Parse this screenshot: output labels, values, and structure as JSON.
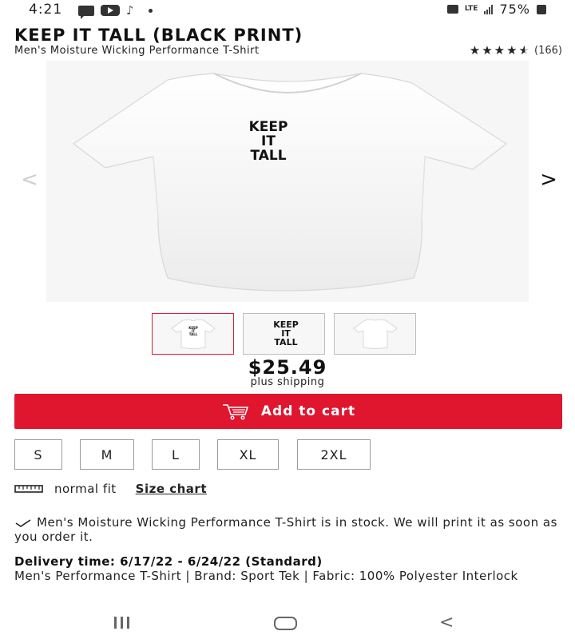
{
  "status_bar": {
    "time": "4:21",
    "network": "LTE",
    "battery": "75%"
  },
  "product": {
    "title": "KEEP IT TALL (BLACK PRINT)",
    "subtitle": "Men's Moisture Wicking Performance T-Shirt",
    "rating": 4.5,
    "rating_count": "(166)",
    "print_lines": [
      "KEEP",
      "IT",
      "TALL"
    ],
    "price": "$25.49",
    "shipping": "plus shipping"
  },
  "gallery": {
    "prev_arrow": "<",
    "next_arrow": ">"
  },
  "cart": {
    "button_label": "Add to cart",
    "icon": "cart-icon"
  },
  "sizes": [
    "S",
    "M",
    "L",
    "XL",
    "2XL"
  ],
  "fit": {
    "icon": "ruler-icon",
    "label": "normal fit",
    "size_chart_link": "Size chart"
  },
  "stock": {
    "check_icon": "check-icon",
    "message": "Men's Moisture Wicking Performance T-Shirt is in stock. We will print it as soon as you order it."
  },
  "delivery": {
    "label": "Delivery time: 6/17/22 - 6/24/22 (Standard)"
  },
  "description": "Men's Performance T-Shirt | Brand: Sport Tek | Fabric: 100% Polyester Interlock",
  "colors": {
    "accent": "#e0162f",
    "shirt": "#ffffff",
    "print": "#111111"
  }
}
